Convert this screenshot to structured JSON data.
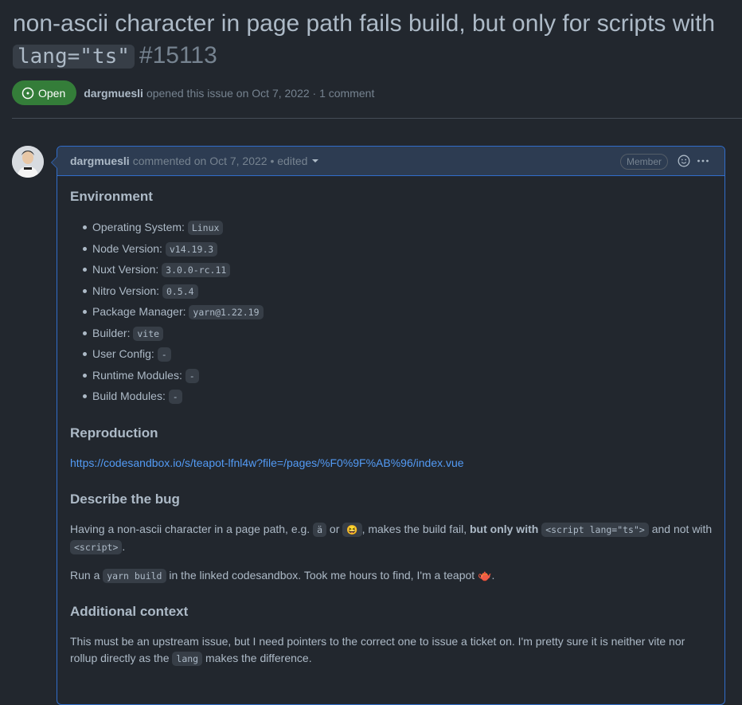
{
  "issue": {
    "title_text": "non-ascii character in page path fails build, but only for scripts with",
    "title_code": "lang=\"ts\"",
    "number": "#15113",
    "state": "Open",
    "author": "dargmuesli",
    "opened_text": "opened this issue on Oct 7, 2022 · 1 comment"
  },
  "comment": {
    "author": "dargmuesli",
    "meta": "commented on Oct 7, 2022 • edited",
    "badge": "Member",
    "sections": {
      "environment": "Environment",
      "reproduction": "Reproduction",
      "describe": "Describe the bug",
      "additional": "Additional context"
    },
    "env": [
      {
        "label": "Operating System:",
        "value": "Linux"
      },
      {
        "label": "Node Version:",
        "value": "v14.19.3"
      },
      {
        "label": "Nuxt Version:",
        "value": "3.0.0-rc.11"
      },
      {
        "label": "Nitro Version:",
        "value": "0.5.4"
      },
      {
        "label": "Package Manager:",
        "value": "yarn@1.22.19"
      },
      {
        "label": "Builder:",
        "value": "vite"
      },
      {
        "label": "User Config:",
        "value": "-"
      },
      {
        "label": "Runtime Modules:",
        "value": "-"
      },
      {
        "label": "Build Modules:",
        "value": "-"
      }
    ],
    "repro_link": "https://codesandbox.io/s/teapot-lfnl4w?file=/pages/%F0%9F%AB%96/index.vue",
    "bug_p1": {
      "t1": "Having a non-ascii character in a page path, e.g.",
      "c1": "ä",
      "t2": "or",
      "c2": "😆",
      "t3": ", makes the build fail,",
      "bold": "but only with",
      "c3": "<script lang=\"ts\">",
      "t4": "and not with",
      "c4": "<script>",
      "t5": "."
    },
    "bug_p2": {
      "t1": "Run a",
      "c1": "yarn build",
      "t2": "in the linked codesandbox. Took me hours to find, I'm a teapot 🫖."
    },
    "context_p": {
      "t1": "This must be an upstream issue, but I need pointers to the correct one to issue a ticket on. I'm pretty sure it is neither vite nor rollup directly as the",
      "c1": "lang",
      "t2": "makes the difference."
    }
  }
}
